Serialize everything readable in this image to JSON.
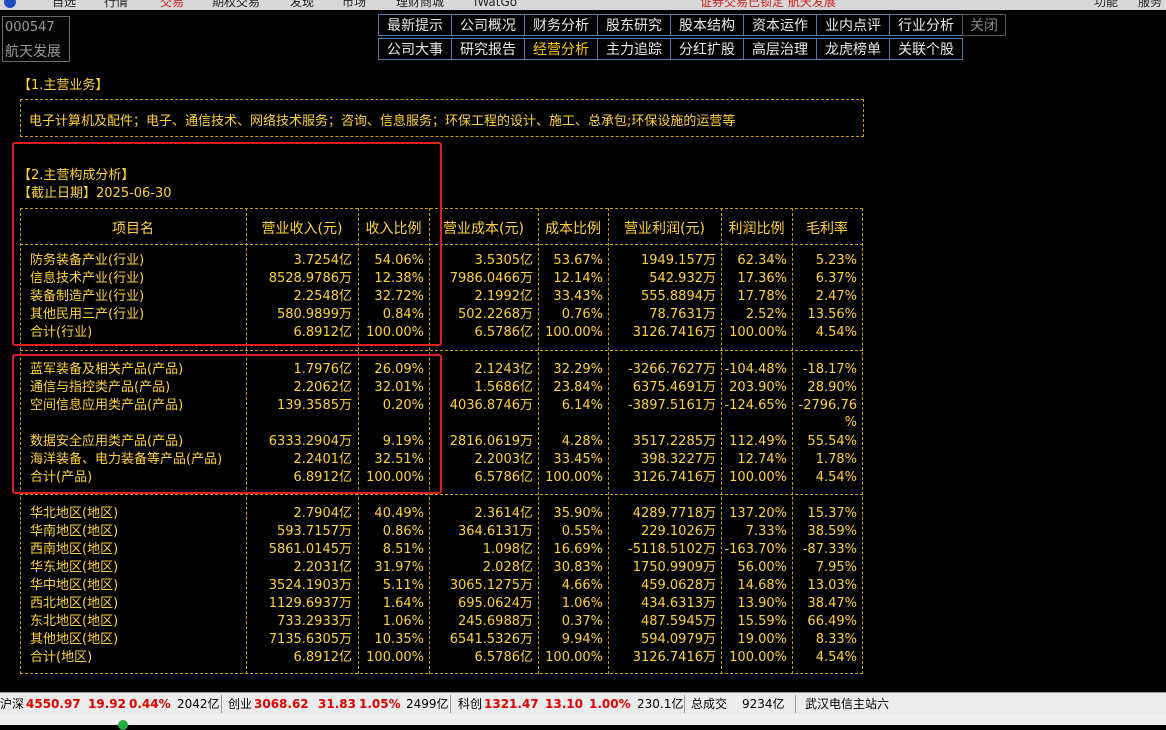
{
  "topbar": {
    "items": [
      "自选",
      "行情",
      "交易",
      "期权交易",
      "发现",
      "市场",
      "理财商城",
      "iWatGo"
    ],
    "active_index": 2,
    "center_text": "证券交易已锁定 航天发展",
    "right_items": [
      "功能",
      "服务"
    ]
  },
  "stock": {
    "code": "000547",
    "name": "航天发展"
  },
  "nav": {
    "row1": [
      "最新提示",
      "公司概况",
      "财务分析",
      "股东研究",
      "股本结构",
      "资本运作",
      "业内点评",
      "行业分析"
    ],
    "close": "关闭",
    "row2": [
      "公司大事",
      "研究报告",
      "经营分析",
      "主力追踪",
      "分红扩股",
      "高层治理",
      "龙虎榜单",
      "关联个股"
    ],
    "active": "经营分析"
  },
  "section1": {
    "title": "【1.主营业务】",
    "text": "电子计算机及配件；电子、通信技术、网络技术服务；咨询、信息服务；环保工程的设计、施工、总承包;环保设施的运营等"
  },
  "section2": {
    "title": "【2.主营构成分析】",
    "date": "【截止日期】2025-06-30"
  },
  "table": {
    "headers": [
      "项目名",
      "营业收入(元)",
      "收入比例",
      "营业成本(元)",
      "成本比例",
      "营业利润(元)",
      "利润比例",
      "毛利率"
    ],
    "industry": [
      [
        "防务装备产业(行业)",
        "3.7254亿",
        "54.06%",
        "3.5305亿",
        "53.67%",
        "1949.157万",
        "62.34%",
        "5.23%"
      ],
      [
        "信息技术产业(行业)",
        "8528.9786万",
        "12.38%",
        "7986.0466万",
        "12.14%",
        "542.932万",
        "17.36%",
        "6.37%"
      ],
      [
        "装备制造产业(行业)",
        "2.2548亿",
        "32.72%",
        "2.1992亿",
        "33.43%",
        "555.8894万",
        "17.78%",
        "2.47%"
      ],
      [
        "其他民用三产(行业)",
        "580.9899万",
        "0.84%",
        "502.2268万",
        "0.76%",
        "78.7631万",
        "2.52%",
        "13.56%"
      ],
      [
        "合计(行业)",
        "6.8912亿",
        "100.00%",
        "6.5786亿",
        "100.00%",
        "3126.7416万",
        "100.00%",
        "4.54%"
      ]
    ],
    "product": [
      [
        "蓝军装备及相关产品(产品)",
        "1.7976亿",
        "26.09%",
        "2.1243亿",
        "32.29%",
        "-3266.7627万",
        "-104.48%",
        "-18.17%"
      ],
      [
        "通信与指控类产品(产品)",
        "2.2062亿",
        "32.01%",
        "1.5686亿",
        "23.84%",
        "6375.4691万",
        "203.90%",
        "28.90%"
      ],
      [
        "空间信息应用类产品(产品)",
        "139.3585万",
        "0.20%",
        "4036.8746万",
        "6.14%",
        "-3897.5161万",
        "-124.65%",
        "-2796.76"
      ],
      [
        "数据安全应用类产品(产品)",
        "6333.2904万",
        "9.19%",
        "2816.0619万",
        "4.28%",
        "3517.2285万",
        "112.49%",
        "55.54%"
      ],
      [
        "海洋装备、电力装备等产品(产品)",
        "2.2401亿",
        "32.51%",
        "2.2003亿",
        "33.45%",
        "398.3227万",
        "12.74%",
        "1.78%"
      ],
      [
        "合计(产品)",
        "6.8912亿",
        "100.00%",
        "6.5786亿",
        "100.00%",
        "3126.7416万",
        "100.00%",
        "4.54%"
      ]
    ],
    "product_wrap": "%",
    "region": [
      [
        "华北地区(地区)",
        "2.7904亿",
        "40.49%",
        "2.3614亿",
        "35.90%",
        "4289.7718万",
        "137.20%",
        "15.37%"
      ],
      [
        "华南地区(地区)",
        "593.7157万",
        "0.86%",
        "364.6131万",
        "0.55%",
        "229.1026万",
        "7.33%",
        "38.59%"
      ],
      [
        "西南地区(地区)",
        "5861.0145万",
        "8.51%",
        "1.098亿",
        "16.69%",
        "-5118.5102万",
        "-163.70%",
        "-87.33%"
      ],
      [
        "华东地区(地区)",
        "2.2031亿",
        "31.97%",
        "2.028亿",
        "30.83%",
        "1750.9909万",
        "56.00%",
        "7.95%"
      ],
      [
        "华中地区(地区)",
        "3524.1903万",
        "5.11%",
        "3065.1275万",
        "4.66%",
        "459.0628万",
        "14.68%",
        "13.03%"
      ],
      [
        "西北地区(地区)",
        "1129.6937万",
        "1.64%",
        "695.0624万",
        "1.06%",
        "434.6313万",
        "13.90%",
        "38.47%"
      ],
      [
        "东北地区(地区)",
        "733.2933万",
        "1.06%",
        "245.6988万",
        "0.37%",
        "487.5945万",
        "15.59%",
        "66.49%"
      ],
      [
        "其他地区(地区)",
        "7135.6305万",
        "10.35%",
        "6541.5326万",
        "9.94%",
        "594.0979万",
        "19.00%",
        "8.33%"
      ],
      [
        "合计(地区)",
        "6.8912亿",
        "100.00%",
        "6.5786亿",
        "100.00%",
        "3126.7416万",
        "100.00%",
        "4.54%"
      ]
    ]
  },
  "status": {
    "sh_label": "沪深",
    "sh_value": "4550.97",
    "sh_change": "19.92",
    "sh_pct": "0.44%",
    "sh_amount": "2042亿",
    "cy_label": "创业",
    "cy_value": "3068.62",
    "cy_change": "31.83",
    "cy_pct": "1.05%",
    "cy_amount": "2499亿",
    "kc_label": "科创",
    "kc_value": "1321.47",
    "kc_change": "13.10",
    "kc_pct": "1.00%",
    "kc_amount": "230.1亿",
    "total_label": "总成交",
    "total_value": "9234亿",
    "server": "武汉电信主站六"
  },
  "colors": {
    "accent": "#ffd23c",
    "highlight": "#e02020",
    "nav_border": "#4c7fb0",
    "active_nav": "#ffc800"
  }
}
